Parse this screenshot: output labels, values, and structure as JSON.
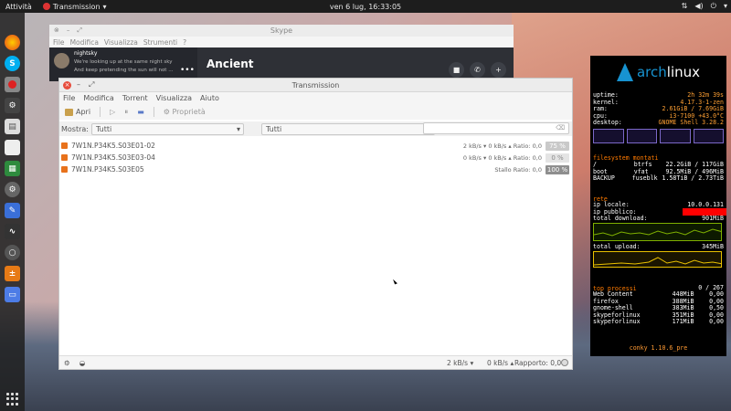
{
  "topbar": {
    "activities": "Attività",
    "app_name": "Transmission",
    "clock": "ven 6 lug, 16:33:05"
  },
  "skype": {
    "window_title": "Skype",
    "menu": [
      "File",
      "Modifica",
      "Visualizza",
      "Strumenti",
      "?"
    ],
    "contact_name": "nightsky",
    "message_line_1": "We're looking up at the same night sky",
    "message_line_2": "And keep pretending the sun will not ...",
    "chat_title": "Ancient"
  },
  "transmission": {
    "window_title": "Transmission",
    "menu": [
      "File",
      "Modifica",
      "Torrent",
      "Visualizza",
      "Aiuto"
    ],
    "toolbar": {
      "open": "Apri",
      "properties": "Proprietà"
    },
    "filter": {
      "label": "Mostra:",
      "combo1": "Tutti",
      "combo2": "Tutti",
      "search_placeholder": ""
    },
    "torrents": [
      {
        "name": "7W1N.P34K5.S03E01-02",
        "stats": "2 kB/s ▾  0 kB/s ▴  Ratio: 0,0",
        "percent": "75 %"
      },
      {
        "name": "7W1N.P34K5.S03E03-04",
        "stats": "0 kB/s ▾  0 kB/s ▴  Ratio: 0,0",
        "percent": "0 %"
      },
      {
        "name": "7W1N.P34K5.S03E05",
        "stats": "Stallo  Ratio: 0,0",
        "percent": "100 %"
      }
    ],
    "status": {
      "download": "2 kB/s ▾",
      "upload": "0 kB/s ▴",
      "ratio": "Rapporto: 0,0"
    }
  },
  "conky": {
    "logo_left": "arch",
    "logo_right": "linux",
    "system": [
      {
        "k": "uptime:",
        "v": "2h 32m 39s"
      },
      {
        "k": "kernel:",
        "v": "4.17.3-1-zen"
      },
      {
        "k": "ram:",
        "v": "2.61GiB / 7.69GiB"
      },
      {
        "k": "cpu:",
        "v": "i3-7100 +43.0°C"
      },
      {
        "k": "desktop:",
        "v": "GNOME Shell 3.28.2"
      }
    ],
    "fs_title": "filesystem montati",
    "filesystems": [
      {
        "m": "/",
        "t": "btrfs",
        "v": "22.2GiB / 117GiB"
      },
      {
        "m": "boot",
        "t": "vfat",
        "v": "92.5MiB / 496MiB"
      },
      {
        "m": "BACKUP",
        "t": "fuseblk",
        "v": "1.58TiB / 2.73TiB"
      }
    ],
    "net_title": "rete",
    "ip_local_label": "ip locale:",
    "ip_local": "10.0.0.131",
    "ip_public_label": "ip pubblico:",
    "total_download_label": "total download:",
    "total_download": "901MiB",
    "total_upload_label": "total upload:",
    "total_upload": "345MiB",
    "proc_title": "top processi",
    "proc_count": "0 / 267",
    "processes": [
      {
        "n": "Web Content",
        "m": "448MiB",
        "c": "0,00"
      },
      {
        "n": "firefox",
        "m": "388MiB",
        "c": "0,00"
      },
      {
        "n": "gnome-shell",
        "m": "383MiB",
        "c": "0,50"
      },
      {
        "n": "skypeforlinux",
        "m": "351MiB",
        "c": "0,00"
      },
      {
        "n": "skypeforlinux",
        "m": "171MiB",
        "c": "0,00"
      }
    ],
    "footer": "conky 1.10.6_pre"
  }
}
